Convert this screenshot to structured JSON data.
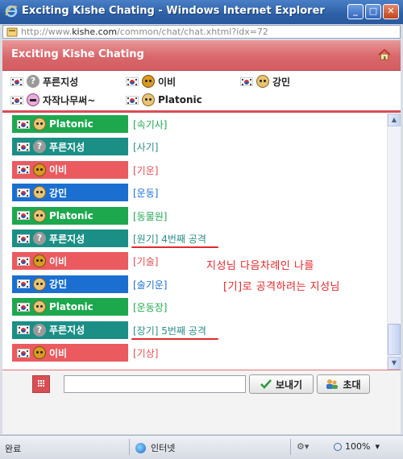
{
  "window": {
    "title": "Exciting Kishe Chating - Windows Internet Explorer",
    "minimize": "_",
    "maximize": "□",
    "close": "✕"
  },
  "address": {
    "prefix": "http://www.",
    "domain": "kishe.com",
    "path": "/common/chat/chat.xhtml?idx=72"
  },
  "chat": {
    "header": "Exciting Kishe Chating",
    "users": [
      {
        "name": "푸른지성",
        "avatar": "question-icon"
      },
      {
        "name": "이비",
        "avatar": "bear-icon"
      },
      {
        "name": "강민",
        "avatar": "cat-icon"
      },
      {
        "name": "자작나무써~",
        "avatar": "pink-icon"
      },
      {
        "name": "Platonic",
        "avatar": "cat-icon"
      }
    ],
    "messages": [
      {
        "name": "Platonic",
        "text": "[속기사]",
        "bg": "#1ea84e",
        "color": "#1ea84e",
        "avatar": "cat-icon"
      },
      {
        "name": "푸른지성",
        "text": "[사기]",
        "bg": "#1b8f86",
        "color": "#2a8c86",
        "avatar": "question-icon"
      },
      {
        "name": "이비",
        "text": "[기운]",
        "bg": "#ea5a5f",
        "color": "#e24e54",
        "avatar": "bear-icon"
      },
      {
        "name": "강민",
        "text": "[운동]",
        "bg": "#1a6fd1",
        "color": "#1a6fd1",
        "avatar": "cat-icon"
      },
      {
        "name": "Platonic",
        "text": "[동물원]",
        "bg": "#1ea84e",
        "color": "#1ea84e",
        "avatar": "cat-icon"
      },
      {
        "name": "푸른지성",
        "text": "[원기] 4번째 공격",
        "bg": "#1b8f86",
        "color": "#2a8c86",
        "avatar": "question-icon"
      },
      {
        "name": "이비",
        "text": "[기술]",
        "bg": "#ea5a5f",
        "color": "#e24e54",
        "avatar": "bear-icon"
      },
      {
        "name": "강민",
        "text": "[술기운]",
        "bg": "#1a6fd1",
        "color": "#1a6fd1",
        "avatar": "cat-icon"
      },
      {
        "name": "Platonic",
        "text": "[운동장]",
        "bg": "#1ea84e",
        "color": "#1ea84e",
        "avatar": "cat-icon"
      },
      {
        "name": "푸른지성",
        "text": "[장기] 5번째 공격",
        "bg": "#1b8f86",
        "color": "#2a8c86",
        "avatar": "question-icon"
      },
      {
        "name": "이비",
        "text": "[기상]",
        "bg": "#ea5a5f",
        "color": "#e24e54",
        "avatar": "bear-icon"
      }
    ],
    "annotation_line1": "지성님 다음차례인 나를",
    "annotation_line2": "[기]로 공격하려는 지성님"
  },
  "input": {
    "value": "",
    "send_label": "보내기",
    "invite_label": "초대"
  },
  "status": {
    "text": "완료",
    "zone": "인터넷",
    "zoom": "100%"
  },
  "colors": {
    "accent": "#d9676b",
    "annotation": "#e0262a"
  }
}
